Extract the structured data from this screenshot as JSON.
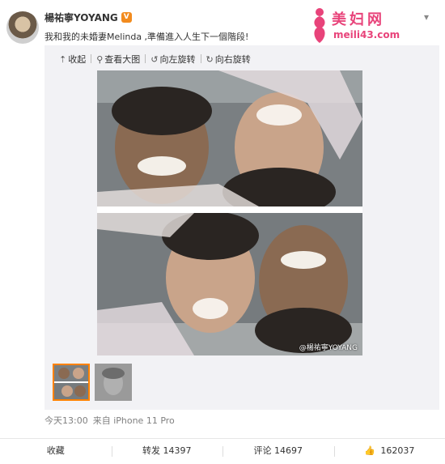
{
  "header": {
    "username": "楊祐寧YOYANG",
    "badge": "V",
    "caret": "▾"
  },
  "post": {
    "text": "我和我的未婚妻Melinda ,準備進入人生下一個階段!"
  },
  "watermark": {
    "title": "美妇网",
    "url": "meili43.com"
  },
  "toolbar": {
    "collapse": "收起",
    "view_large": "查看大图",
    "rotate_left": "向左旋转",
    "rotate_right": "向右旋转"
  },
  "photo": {
    "watermark": "@楊祐寧YOYANG"
  },
  "meta": {
    "time": "今天13:00",
    "source": "来自 iPhone 11 Pro"
  },
  "footer": {
    "favorite": "收藏",
    "repost": "转发 14397",
    "comment": "评论 14697",
    "like": "162037"
  },
  "colors": {
    "accent": "#ff8200",
    "watermark": "#e8437a"
  }
}
